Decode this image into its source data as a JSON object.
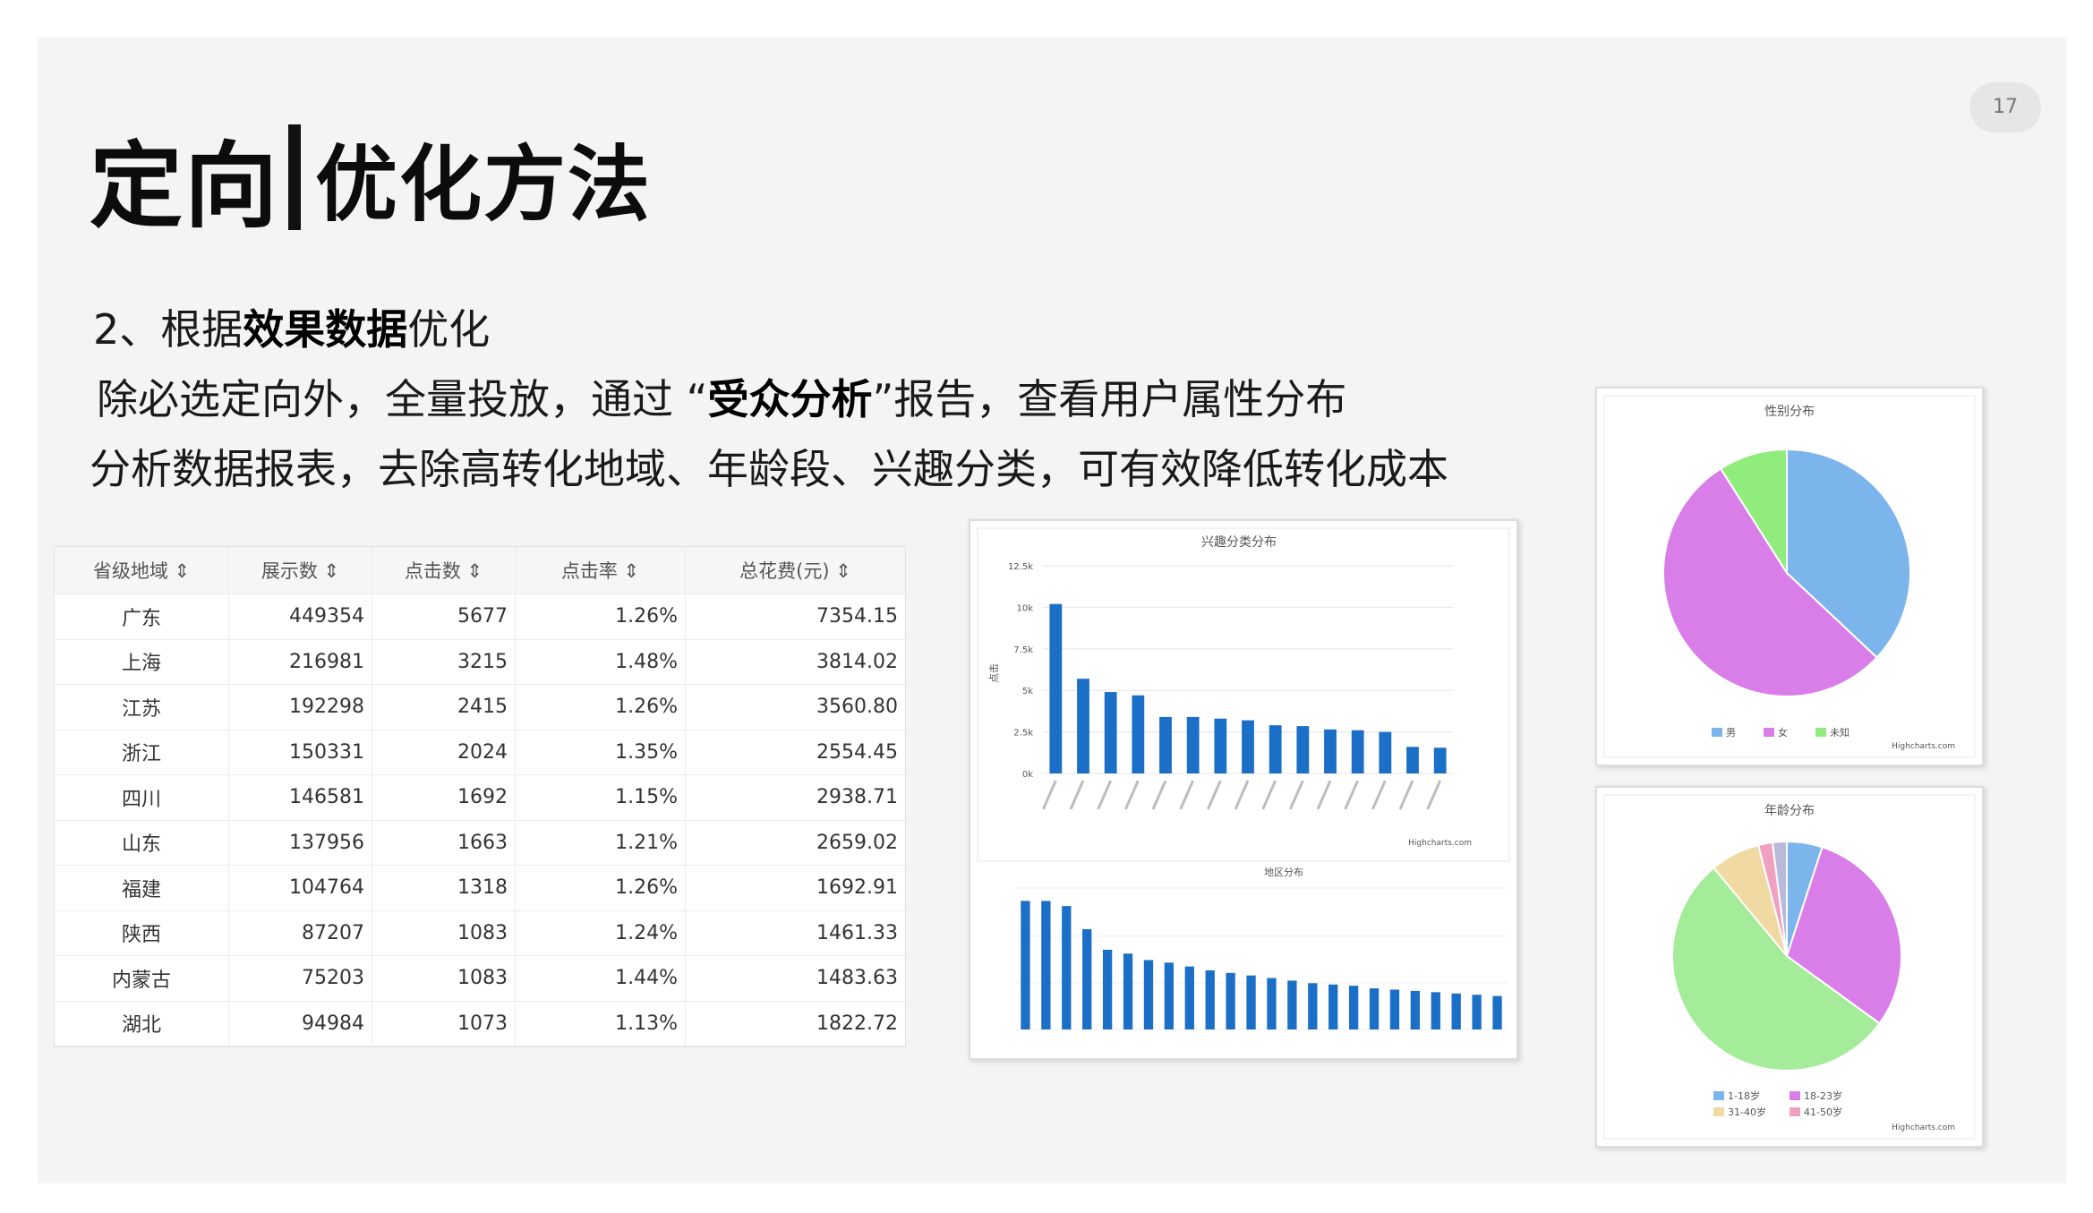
{
  "page_number": "17",
  "title": {
    "main": "定向",
    "sub": "优化方法"
  },
  "section": {
    "prefix": "2、根据",
    "bold": "效果数据",
    "suffix": "优化"
  },
  "body": {
    "line1_pre": "除必选定向外，全量投放，通过 “",
    "line1_bold": "受众分析",
    "line1_post": "”报告，查看用户属性分布",
    "line2": "分析数据报表，去除高转化地域、年龄段、兴趣分类，可有效降低转化成本"
  },
  "table": {
    "headers": [
      "省级地域 ⇕",
      "展示数 ⇕",
      "点击数 ⇕",
      "点击率 ⇕",
      "总花费(元) ⇕"
    ],
    "rows": [
      [
        "广东",
        "449354",
        "5677",
        "1.26%",
        "7354.15"
      ],
      [
        "上海",
        "216981",
        "3215",
        "1.48%",
        "3814.02"
      ],
      [
        "江苏",
        "192298",
        "2415",
        "1.26%",
        "3560.80"
      ],
      [
        "浙江",
        "150331",
        "2024",
        "1.35%",
        "2554.45"
      ],
      [
        "四川",
        "146581",
        "1692",
        "1.15%",
        "2938.71"
      ],
      [
        "山东",
        "137956",
        "1663",
        "1.21%",
        "2659.02"
      ],
      [
        "福建",
        "104764",
        "1318",
        "1.26%",
        "1692.91"
      ],
      [
        "陕西",
        "87207",
        "1083",
        "1.24%",
        "1461.33"
      ],
      [
        "内蒙古",
        "75203",
        "1083",
        "1.44%",
        "1483.63"
      ],
      [
        "湖北",
        "94984",
        "1073",
        "1.13%",
        "1822.72"
      ]
    ]
  },
  "chart_data": [
    {
      "type": "bar",
      "title": "兴趣分类分布",
      "ylabel": "点击",
      "yticks": [
        "0k",
        "2.5k",
        "5k",
        "7.5k",
        "10k",
        "12.5k"
      ],
      "ylim": [
        0,
        12500
      ],
      "values": [
        10200,
        5700,
        4900,
        4700,
        3400,
        3400,
        3300,
        3200,
        2900,
        2850,
        2650,
        2600,
        2500,
        1600,
        1550
      ],
      "credit": "Highcharts.com",
      "color": "#1c6fc7"
    },
    {
      "type": "bar",
      "title": "地区分布",
      "values": [
        100,
        100,
        96,
        78,
        62,
        59,
        54,
        52,
        49,
        46,
        44,
        42,
        40,
        38,
        36,
        35,
        34,
        32,
        31,
        30,
        29,
        28,
        27,
        26
      ],
      "color": "#1c6fc7"
    },
    {
      "type": "pie",
      "title": "性别分布",
      "slices": [
        {
          "label": "男",
          "value": 37,
          "color": "#7cb5ec"
        },
        {
          "label": "女",
          "value": 54,
          "color": "#d97ee8"
        },
        {
          "label": "未知",
          "value": 9,
          "color": "#90ed7d"
        }
      ],
      "credit": "Highcharts.com"
    },
    {
      "type": "pie",
      "title": "年龄分布",
      "slices": [
        {
          "label": "1-18岁",
          "value": 5,
          "color": "#7cb5ec"
        },
        {
          "label": "18-23岁",
          "value": 30,
          "color": "#d97ee8"
        },
        {
          "label": "",
          "value": 54,
          "color": "#a5ec9a"
        },
        {
          "label": "31-40岁",
          "value": 7,
          "color": "#f0d9a2"
        },
        {
          "label": "41-50岁",
          "value": 2,
          "color": "#f0a0c0"
        },
        {
          "label": "",
          "value": 2,
          "color": "#b9b9d9"
        }
      ],
      "credit": "Highcharts.com"
    }
  ]
}
